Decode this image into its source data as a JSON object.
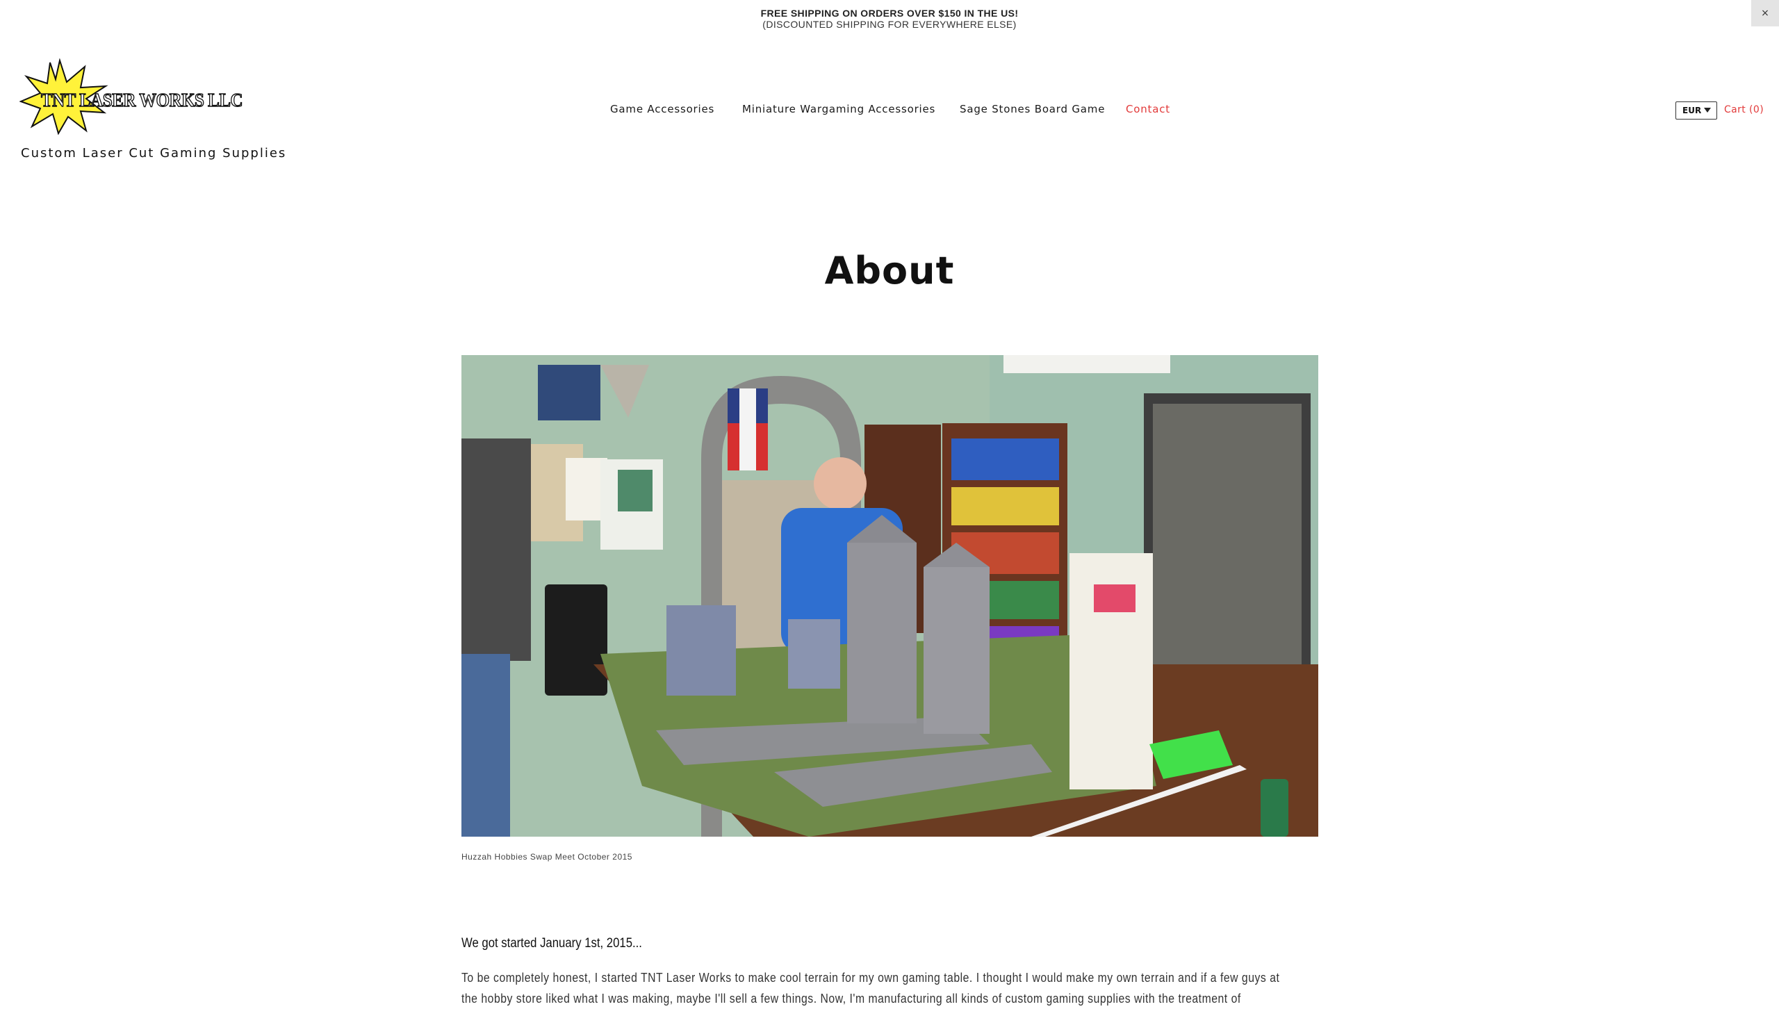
{
  "promo": {
    "line1": "FREE SHIPPING ON ORDERS OVER $150 IN THE US!",
    "line2": "(DISCOUNTED SHIPPING FOR EVERYWHERE ELSE)",
    "close_label": "×"
  },
  "brand": {
    "logo_text": "TNT LASER WORKS LLC",
    "tagline": "Custom Laser Cut Gaming Supplies"
  },
  "nav": {
    "items": [
      {
        "label": "Game Accessories",
        "active": false
      },
      {
        "label": "Miniature Wargaming Accessories",
        "active": false
      },
      {
        "label": "Sage Stones Board Game",
        "active": false
      },
      {
        "label": "Contact",
        "active": true
      }
    ]
  },
  "header_right": {
    "currency": "EUR",
    "cart_label": "Cart (0)"
  },
  "page": {
    "title": "About",
    "photo_caption": "Huzzah Hobbies Swap Meet October 2015",
    "lead": "We got started January 1st, 2015...",
    "body": "To be completely honest, I started TNT Laser Works to make cool terrain for my own gaming table. I thought I would make my own terrain and if a few guys at the hobby store liked what I was making, maybe I'll sell a few things. Now, I'm manufacturing all kinds of custom gaming supplies with the treatment of"
  },
  "colors": {
    "accent": "#e23a3a",
    "logo_star": "#fff23a",
    "text": "#111111"
  }
}
